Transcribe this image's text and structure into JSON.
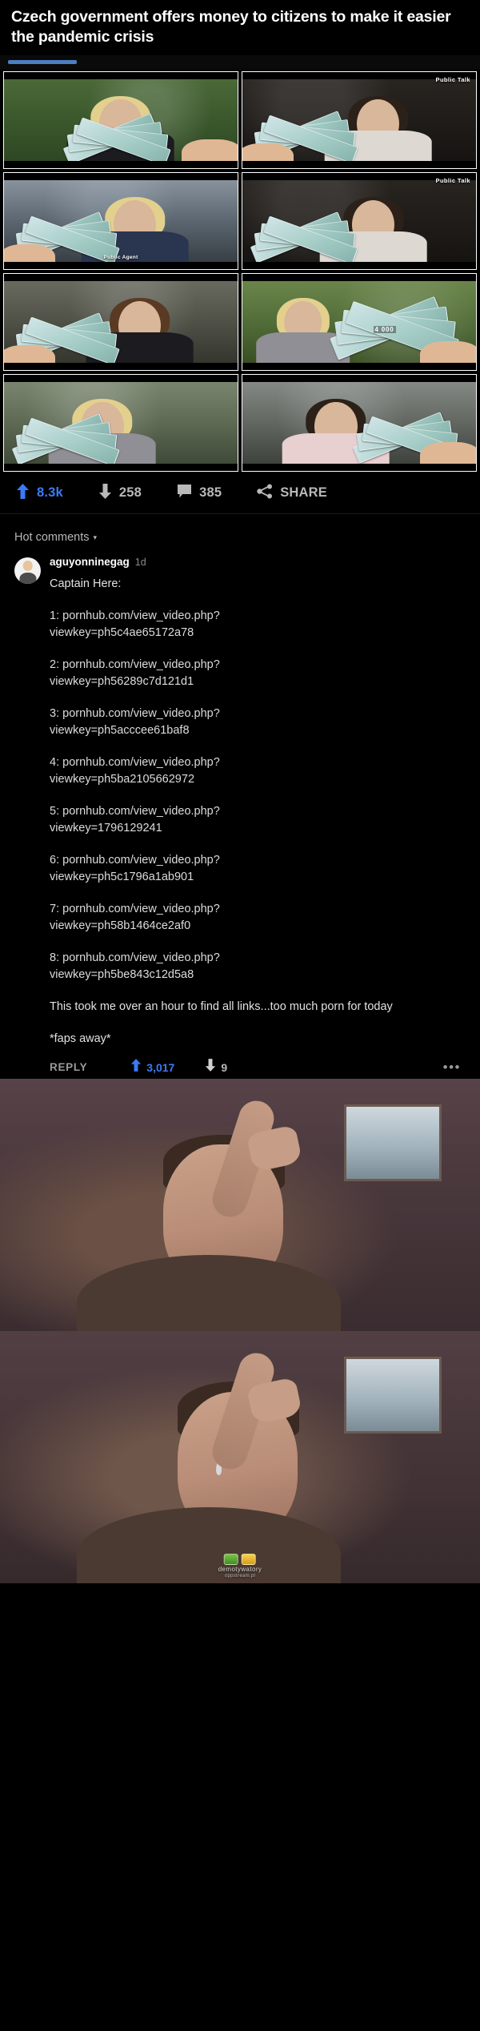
{
  "post": {
    "title": "Czech government offers money to citizens to make it easier the pandemic crisis",
    "progress_label": "seek-bar"
  },
  "gallery": {
    "items": [
      {
        "id": 1,
        "watermark": "",
        "bottom_watermark": "",
        "amount": ""
      },
      {
        "id": 2,
        "watermark": "Public Talk",
        "bottom_watermark": "",
        "amount": ""
      },
      {
        "id": 3,
        "watermark": "",
        "bottom_watermark": "Public Agent",
        "amount": ""
      },
      {
        "id": 4,
        "watermark": "Public Talk",
        "bottom_watermark": "",
        "amount": ""
      },
      {
        "id": 5,
        "watermark": "",
        "bottom_watermark": "",
        "amount": ""
      },
      {
        "id": 6,
        "watermark": "",
        "bottom_watermark": "",
        "amount": "4 000"
      },
      {
        "id": 7,
        "watermark": "",
        "bottom_watermark": "",
        "amount": ""
      },
      {
        "id": 8,
        "watermark": "",
        "bottom_watermark": "",
        "amount": ""
      }
    ]
  },
  "stats": {
    "upvotes": "8.3k",
    "downvotes": "258",
    "comments": "385",
    "share_label": "SHARE",
    "upvote_color": "#3b7bf5"
  },
  "comments_section": {
    "sort_label": "Hot comments",
    "caret": "▾",
    "comment": {
      "username": "aguyonninegag",
      "time": "1d",
      "intro": "Captain Here:",
      "links": [
        {
          "index": "1: ",
          "url": "pornhub.com/view_video.php?",
          "viewkey": "viewkey=ph5c4ae65172a78"
        },
        {
          "index": "2: ",
          "url": "pornhub.com/view_video.php?",
          "viewkey": "viewkey=ph56289c7d121d1"
        },
        {
          "index": "3: ",
          "url": "pornhub.com/view_video.php?",
          "viewkey": "viewkey=ph5acccee61baf8"
        },
        {
          "index": "4: ",
          "url": "pornhub.com/view_video.php?",
          "viewkey": "viewkey=ph5ba2105662972"
        },
        {
          "index": "5: ",
          "url": "pornhub.com/view_video.php?",
          "viewkey": "viewkey=1796129241"
        },
        {
          "index": "6: ",
          "url": "pornhub.com/view_video.php?",
          "viewkey": "viewkey=ph5c1796a1ab901"
        },
        {
          "index": "7: ",
          "url": "pornhub.com/view_video.php?",
          "viewkey": "viewkey=ph58b1464ce2af0"
        },
        {
          "index": "8: ",
          "url": "pornhub.com/view_video.php?",
          "viewkey": "viewkey=ph5be843c12d5a8"
        }
      ],
      "outro": "This took me over an hour to find all links...too much porn for today",
      "signoff": "*faps away*",
      "reply_label": "REPLY",
      "upvotes": "3,017",
      "downvotes": "9",
      "more_label": "•••"
    }
  },
  "footer": {
    "watermark": "demotywatory",
    "watermark_sub": "oppstream.pl"
  }
}
